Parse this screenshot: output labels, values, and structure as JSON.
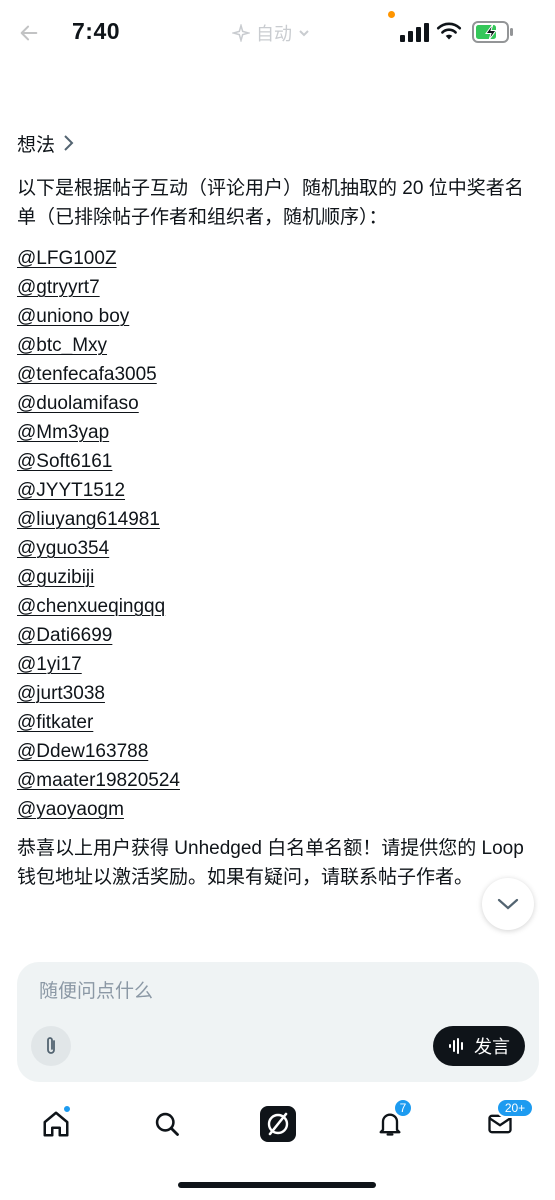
{
  "status_bar": {
    "time": "7:40",
    "mode_label": "自动",
    "accent_dot_color": "#ff9500",
    "battery_color": "#34c759"
  },
  "section": {
    "title": "想法"
  },
  "post": {
    "intro": "以下是根据帖子互动（评论用户）随机抽取的 20 位中奖者名单（已排除帖子作者和组织者，随机顺序）：",
    "winners": [
      "@LFG100Z",
      "@gtryyrt7",
      "@uniono boy",
      "@btc_Mxy",
      "@tenfecafa3005",
      "@duolamifaso",
      "@Mm3yap",
      "@Soft6161",
      "@JYYT1512",
      "@liuyang614981",
      "@yguo354",
      "@guzibiji",
      "@chenxueqingqq",
      "@Dati6699",
      "@1yi17",
      "@jurt3038",
      "@fitkater",
      "@Ddew163788",
      "@maater19820524",
      "@yaoyaogm"
    ],
    "outro": "恭喜以上用户获得 Unhedged 白名单名额！请提供您的 Loop 钱包地址以激活奖励。如果有疑问，请联系帖子作者。"
  },
  "composer": {
    "placeholder": "随便问点什么",
    "send_label": "发言"
  },
  "bottom_nav": {
    "home_icon": "home-icon",
    "search_icon": "search-icon",
    "grok_icon": "grok-icon",
    "notifications_badge": "7",
    "messages_badge": "20+",
    "accent_color": "#1d9bf0"
  }
}
